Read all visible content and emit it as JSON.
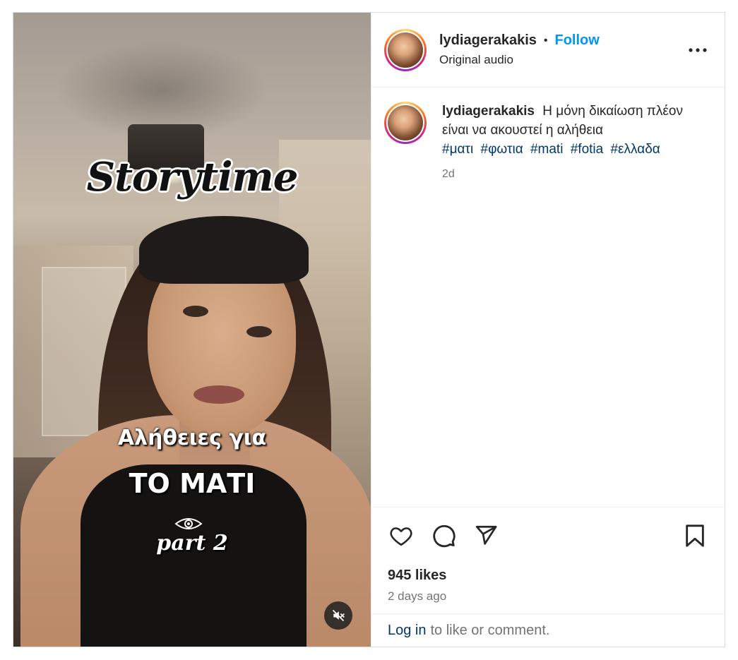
{
  "post": {
    "author": "lydiagerakakis",
    "separator": "•",
    "follow_label": "Follow",
    "audio": "Original audio",
    "more_icon": "more-horizontal-icon"
  },
  "media": {
    "overlay_title": "Storytime",
    "overlay_line1": "Αλήθειες για",
    "overlay_line2": "ΤΟ ΜΑΤΙ",
    "overlay_part": "part 2",
    "mute_icon": "muted-speaker-icon"
  },
  "caption": {
    "username": "lydiagerakakis",
    "text": "Η μόνη δικαίωση πλέον είναι να ακουστεί η αλήθεια",
    "hashtags": [
      "#ματι",
      "#φωτια",
      "#mati",
      "#fotia",
      "#ελλαδα"
    ],
    "time": "2d"
  },
  "actions": {
    "like_icon": "heart-icon",
    "comment_icon": "comment-icon",
    "share_icon": "share-icon",
    "save_icon": "bookmark-icon"
  },
  "stats": {
    "likes": "945 likes",
    "date": "2 days ago"
  },
  "login": {
    "link": "Log in",
    "rest": "to like or comment."
  },
  "colors": {
    "follow": "#0095f6",
    "hashtag": "#00376b",
    "muted_text": "#737373"
  }
}
